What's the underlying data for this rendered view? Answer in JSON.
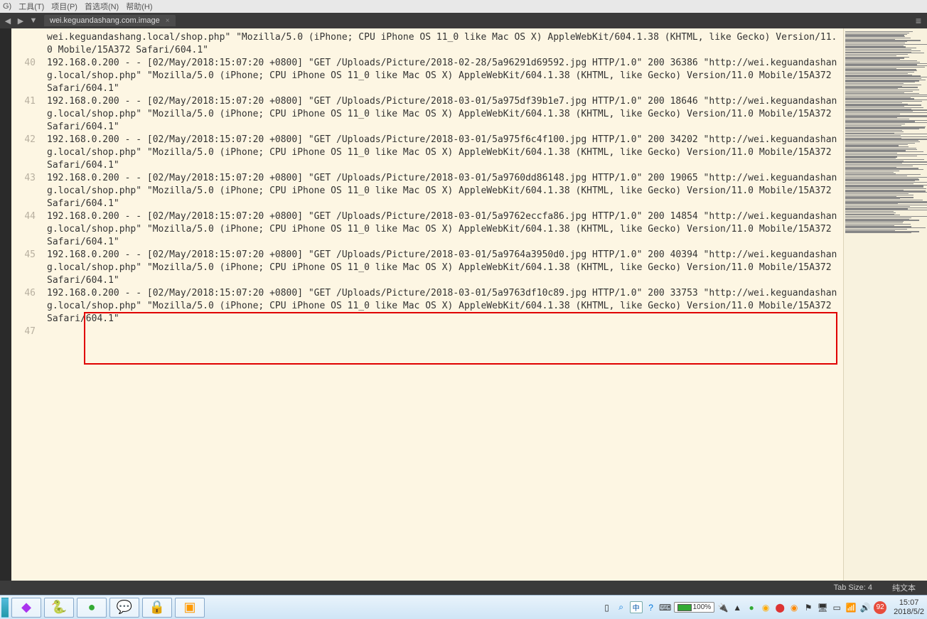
{
  "menubar": [
    "G)",
    "工具(T)",
    "项目(P)",
    "首选项(N)",
    "帮助(H)"
  ],
  "tab": {
    "title": "wei.keguandashang.com.image",
    "close": "×"
  },
  "nav": {
    "back": "◀",
    "fwd": "▶",
    "down": "▼"
  },
  "hamburger": "≡",
  "log": [
    {
      "n": "",
      "t": "wei.keguandashang.local/shop.php\" \"Mozilla/5.0 (iPhone; CPU iPhone OS 11_0 like Mac OS X) AppleWebKit/604.1.38 (KHTML, like Gecko) Version/11.0 Mobile/15A372 Safari/604.1\""
    },
    {
      "n": "40",
      "t": "192.168.0.200 - - [02/May/2018:15:07:20 +0800] \"GET /Uploads/Picture/2018-02-28/5a96291d69592.jpg HTTP/1.0\" 200 36386 \"http://wei.keguandashang.local/shop.php\" \"Mozilla/5.0 (iPhone; CPU iPhone OS 11_0 like Mac OS X) AppleWebKit/604.1.38 (KHTML, like Gecko) Version/11.0 Mobile/15A372 Safari/604.1\""
    },
    {
      "n": "41",
      "t": "192.168.0.200 - - [02/May/2018:15:07:20 +0800] \"GET /Uploads/Picture/2018-03-01/5a975df39b1e7.jpg HTTP/1.0\" 200 18646 \"http://wei.keguandashang.local/shop.php\" \"Mozilla/5.0 (iPhone; CPU iPhone OS 11_0 like Mac OS X) AppleWebKit/604.1.38 (KHTML, like Gecko) Version/11.0 Mobile/15A372 Safari/604.1\""
    },
    {
      "n": "42",
      "t": "192.168.0.200 - - [02/May/2018:15:07:20 +0800] \"GET /Uploads/Picture/2018-03-01/5a975f6c4f100.jpg HTTP/1.0\" 200 34202 \"http://wei.keguandashang.local/shop.php\" \"Mozilla/5.0 (iPhone; CPU iPhone OS 11_0 like Mac OS X) AppleWebKit/604.1.38 (KHTML, like Gecko) Version/11.0 Mobile/15A372 Safari/604.1\""
    },
    {
      "n": "43",
      "t": "192.168.0.200 - - [02/May/2018:15:07:20 +0800] \"GET /Uploads/Picture/2018-03-01/5a9760dd86148.jpg HTTP/1.0\" 200 19065 \"http://wei.keguandashang.local/shop.php\" \"Mozilla/5.0 (iPhone; CPU iPhone OS 11_0 like Mac OS X) AppleWebKit/604.1.38 (KHTML, like Gecko) Version/11.0 Mobile/15A372 Safari/604.1\""
    },
    {
      "n": "44",
      "t": "192.168.0.200 - - [02/May/2018:15:07:20 +0800] \"GET /Uploads/Picture/2018-03-01/5a9762eccfa86.jpg HTTP/1.0\" 200 14854 \"http://wei.keguandashang.local/shop.php\" \"Mozilla/5.0 (iPhone; CPU iPhone OS 11_0 like Mac OS X) AppleWebKit/604.1.38 (KHTML, like Gecko) Version/11.0 Mobile/15A372 Safari/604.1\""
    },
    {
      "n": "45",
      "t": "192.168.0.200 - - [02/May/2018:15:07:20 +0800] \"GET /Uploads/Picture/2018-03-01/5a9764a3950d0.jpg HTTP/1.0\" 200 40394 \"http://wei.keguandashang.local/shop.php\" \"Mozilla/5.0 (iPhone; CPU iPhone OS 11_0 like Mac OS X) AppleWebKit/604.1.38 (KHTML, like Gecko) Version/11.0 Mobile/15A372 Safari/604.1\""
    },
    {
      "n": "46",
      "t": "192.168.0.200 - - [02/May/2018:15:07:20 +0800] \"GET /Uploads/Picture/2018-03-01/5a9763df10c89.jpg HTTP/1.0\" 200 33753 \"http://wei.keguandashang.local/shop.php\" \"Mozilla/5.0 (iPhone; CPU iPhone OS 11_0 like Mac OS X) AppleWebKit/604.1.38 (KHTML, like Gecko) Version/11.0 Mobile/15A372 Safari/604.1\""
    },
    {
      "n": "47",
      "t": ""
    }
  ],
  "status": {
    "tabsize": "Tab Size: 4",
    "syntax": "纯文本"
  },
  "taskbar_icons": [
    "phpstorm",
    "python",
    "360",
    "wechat",
    "tools",
    "sublime"
  ],
  "tray": {
    "ime_label": "中",
    "battery_pct": "100%",
    "badge": "92",
    "time": "15:07",
    "date": "2018/5/2"
  }
}
